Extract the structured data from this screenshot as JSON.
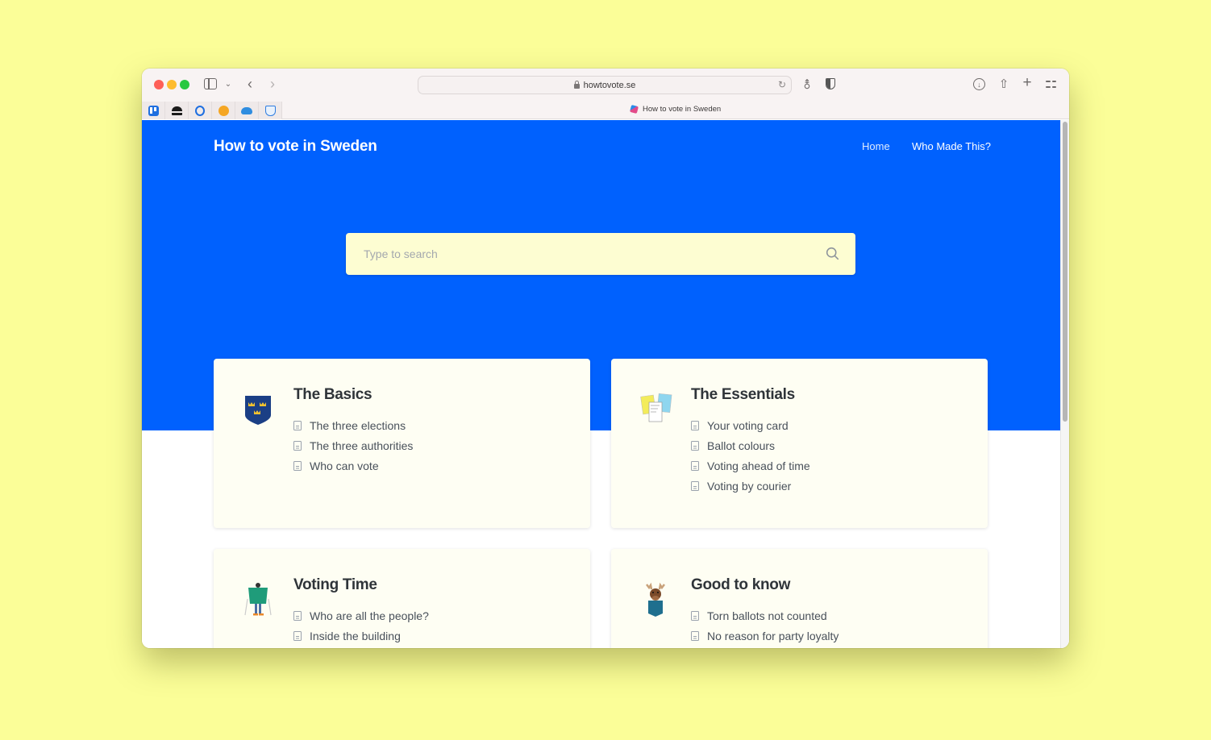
{
  "browser": {
    "url": "howtovote.se",
    "tab_title": "How to vote in Sweden",
    "bookmarks": [
      "trello",
      "hat",
      "bracket",
      "star-chat",
      "cloud",
      "shield"
    ]
  },
  "site": {
    "title": "How to vote in Sweden",
    "nav": [
      {
        "label": "Home"
      },
      {
        "label": "Who Made This?"
      }
    ],
    "search": {
      "placeholder": "Type to search",
      "value": ""
    },
    "colors": {
      "hero": "#0061fe",
      "search_bg": "#fdfdd2",
      "card_bg": "#fefef3",
      "page_bg": "#fbfe98"
    }
  },
  "cards": [
    {
      "title": "The Basics",
      "icon": "swedish-crest-icon",
      "items": [
        "The three elections",
        "The three authorities",
        "Who can vote"
      ]
    },
    {
      "title": "The Essentials",
      "icon": "ballot-papers-icon",
      "items": [
        "Your voting card",
        "Ballot colours",
        "Voting ahead of time",
        "Voting by courier"
      ]
    },
    {
      "title": "Voting Time",
      "icon": "voting-booth-icon",
      "items": [
        "Who are all the people?",
        "Inside the building"
      ]
    },
    {
      "title": "Good to know",
      "icon": "moose-icon",
      "items": [
        "Torn ballots not counted",
        "No reason for party loyalty"
      ]
    }
  ]
}
